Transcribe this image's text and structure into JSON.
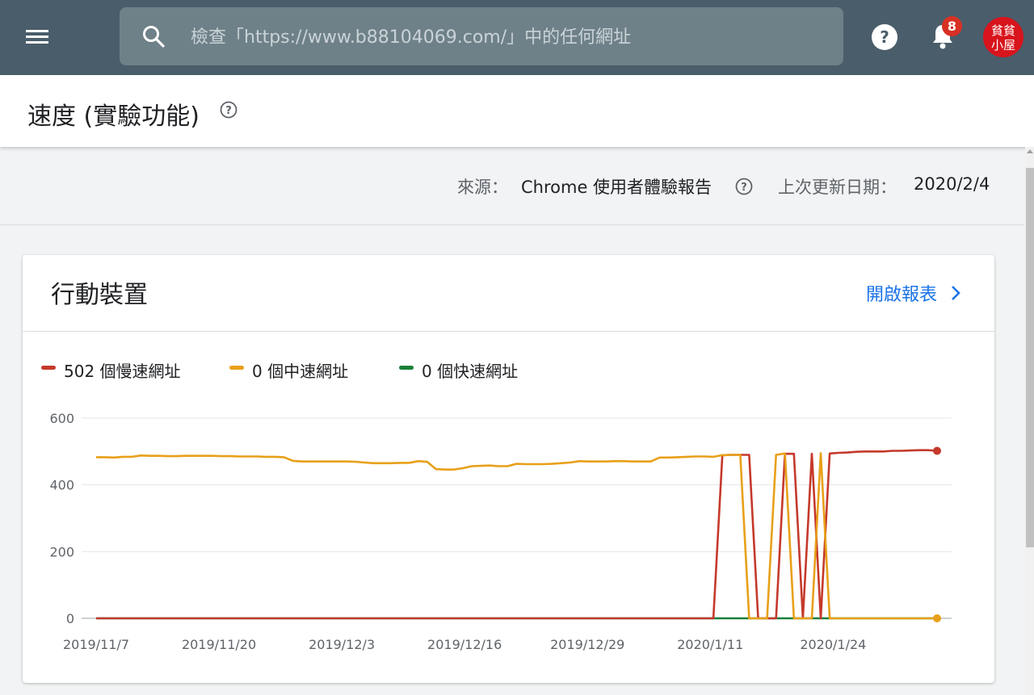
{
  "topbar": {
    "menu_icon": "menu-icon",
    "search": {
      "placeholder": "檢查「https://www.b88104069.com/」中的任何網址",
      "value": ""
    },
    "help_icon": "help-icon",
    "notification_icon": "bell-icon",
    "notification_count": "8",
    "avatar_text_top": "貧貧",
    "avatar_text_bottom": "小屋"
  },
  "page": {
    "title": "速度 (實驗功能)",
    "source_label": "來源：",
    "source_value": "Chrome 使用者體驗報告",
    "updated_label": "上次更新日期：",
    "updated_value": "2020/2/4"
  },
  "card": {
    "title": "行動裝置",
    "open_report_label": "開啟報表"
  },
  "colors": {
    "slow": "#c5392b",
    "moderate": "#e8a019",
    "fast": "#188038",
    "accent": "#1a73e8",
    "topbar": "#4a5d6a"
  },
  "chart_data": {
    "type": "line",
    "legend": [
      "502 個慢速網址",
      "0 個中速網址",
      "0 個快速網址"
    ],
    "legend_placement": "top-left",
    "ylim": [
      0,
      600
    ],
    "yticks": [
      "0",
      "200",
      "400",
      "600"
    ],
    "xticks": [
      "2019/11/7",
      "2019/11/20",
      "2019/12/3",
      "2019/12/16",
      "2019/12/29",
      "2020/1/11",
      "2020/1/24"
    ],
    "x_start": "2019/11/7",
    "x_end": "2020/2/4",
    "grid": true,
    "series": [
      {
        "name": "502 個慢速網址",
        "color": "#c5392b",
        "values": [
          0,
          0,
          0,
          0,
          0,
          0,
          0,
          0,
          0,
          0,
          0,
          0,
          0,
          0,
          0,
          0,
          0,
          0,
          0,
          0,
          0,
          0,
          0,
          0,
          0,
          0,
          0,
          0,
          0,
          0,
          0,
          0,
          0,
          0,
          0,
          0,
          0,
          0,
          0,
          0,
          0,
          0,
          0,
          0,
          0,
          0,
          0,
          0,
          0,
          0,
          0,
          0,
          0,
          0,
          0,
          0,
          0,
          0,
          0,
          0,
          0,
          0,
          0,
          0,
          0,
          0,
          0,
          0,
          0,
          0,
          489,
          490,
          490,
          490,
          0,
          0,
          0,
          493,
          493,
          0,
          493,
          0,
          494,
          496,
          497,
          499,
          500,
          500,
          500,
          502,
          502,
          503,
          504,
          504,
          502
        ]
      },
      {
        "name": "0 個中速網址",
        "color": "#e8a019",
        "values": [
          483,
          483,
          482,
          484,
          484,
          488,
          487,
          487,
          486,
          486,
          487,
          487,
          487,
          487,
          486,
          486,
          485,
          485,
          485,
          484,
          484,
          483,
          472,
          470,
          470,
          470,
          470,
          470,
          470,
          469,
          467,
          465,
          465,
          465,
          466,
          466,
          471,
          469,
          447,
          446,
          446,
          450,
          456,
          457,
          458,
          456,
          456,
          463,
          462,
          462,
          462,
          463,
          465,
          467,
          471,
          470,
          470,
          470,
          471,
          471,
          470,
          470,
          470,
          482,
          482,
          483,
          484,
          485,
          485,
          484,
          489,
          490,
          490,
          0,
          0,
          0,
          490,
          494,
          0,
          0,
          0,
          495,
          0,
          0,
          0,
          0,
          0,
          0,
          0,
          0,
          0,
          0,
          0,
          0,
          0
        ]
      },
      {
        "name": "0 個快速網址",
        "color": "#188038",
        "values": [
          0,
          0,
          0,
          0,
          0,
          0,
          0,
          0,
          0,
          0,
          0,
          0,
          0,
          0,
          0,
          0,
          0,
          0,
          0,
          0,
          0,
          0,
          0,
          0,
          0,
          0,
          0,
          0,
          0,
          0,
          0,
          0,
          0,
          0,
          0,
          0,
          0,
          0,
          0,
          0,
          0,
          0,
          0,
          0,
          0,
          0,
          0,
          0,
          0,
          0,
          0,
          0,
          0,
          0,
          0,
          0,
          0,
          0,
          0,
          0,
          0,
          0,
          0,
          0,
          0,
          0,
          0,
          0,
          0,
          0,
          0,
          0,
          0,
          0,
          0,
          0,
          0,
          0,
          0,
          0,
          0,
          0,
          0,
          0,
          0,
          0,
          0,
          0,
          0,
          0,
          0,
          0,
          0,
          0,
          0
        ]
      }
    ]
  }
}
